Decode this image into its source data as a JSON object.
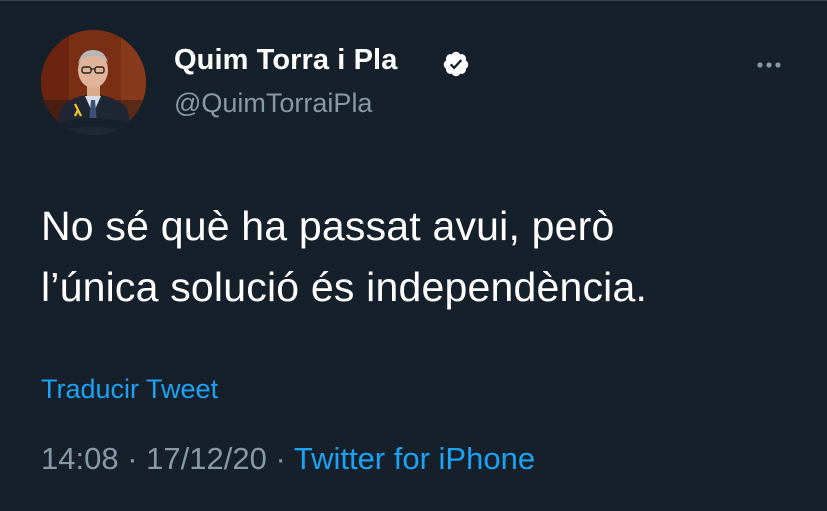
{
  "tweet": {
    "author": {
      "display_name": "Quim Torra i Pla",
      "handle": "@QuimTorraiPla",
      "verified_icon": "verified-badge-icon",
      "avatar": "profile-photo"
    },
    "more_icon": "more-options-icon",
    "text_lines": [
      "No sé què ha passat avui, però",
      "l’única solució és independència."
    ],
    "translate_label": "Traducir Tweet",
    "time": "14:08",
    "separator": "·",
    "date": "17/12/20",
    "source": "Twitter for iPhone"
  },
  "colors": {
    "background": "#15202b",
    "text_primary": "#ffffff",
    "text_secondary": "#8899a6",
    "accent": "#1da1f2"
  }
}
